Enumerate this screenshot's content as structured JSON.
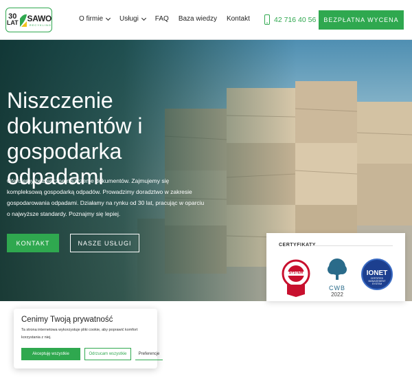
{
  "header": {
    "logo": {
      "years_num": "30",
      "years_word": "LAT",
      "brand": "SAWO",
      "brand_sub": "RECYKLING"
    },
    "nav": [
      {
        "label": "O firmie",
        "dropdown": true
      },
      {
        "label": "Usługi",
        "dropdown": true
      },
      {
        "label": "FAQ",
        "dropdown": false
      },
      {
        "label": "Baza wiedzy",
        "dropdown": false
      },
      {
        "label": "Kontakt",
        "dropdown": false
      }
    ],
    "phone": "42 716 40 56",
    "cta": "BEZPŁATNA WYCENA"
  },
  "hero": {
    "title": "Niszczenie dokumentów i gospodarka odpadami",
    "text": "Oferujemy bezpieczne niszczenie dokumentów. Zajmujemy się kompleksową gospodarką odpadów. Prowadzimy doradztwo w zakresie gospodarowania odpadami. Działamy na rynku od 30 lat, pracując w oparciu o najwyższe standardy. Poznajmy się lepiej.",
    "btn_contact": "KONTAKT",
    "btn_services": "NASZE USŁUGI"
  },
  "certificates": {
    "title": "CERTYFIKATY",
    "items": [
      {
        "name": "system-certificate",
        "label": "SYSTEM"
      },
      {
        "name": "cwb-certificate",
        "label": "CWB",
        "year": "2022"
      },
      {
        "name": "ionet-certificate",
        "label": "IONET",
        "sub": "CERTIFIED MANAGEMENT SYSTEM"
      }
    ]
  },
  "cookie": {
    "title": "Cenimy Twoją prywatność",
    "text": "Ta strona internetowa wykorzystuje pliki cookie, aby poprawić komfort korzystania z niej.",
    "accept": "Akceptuję wszystkie",
    "reject": "Odrzucam wszystkie",
    "prefs": "Preferencje"
  },
  "colors": {
    "accent": "#2fa84f",
    "hero_overlay": "#0c302c"
  }
}
